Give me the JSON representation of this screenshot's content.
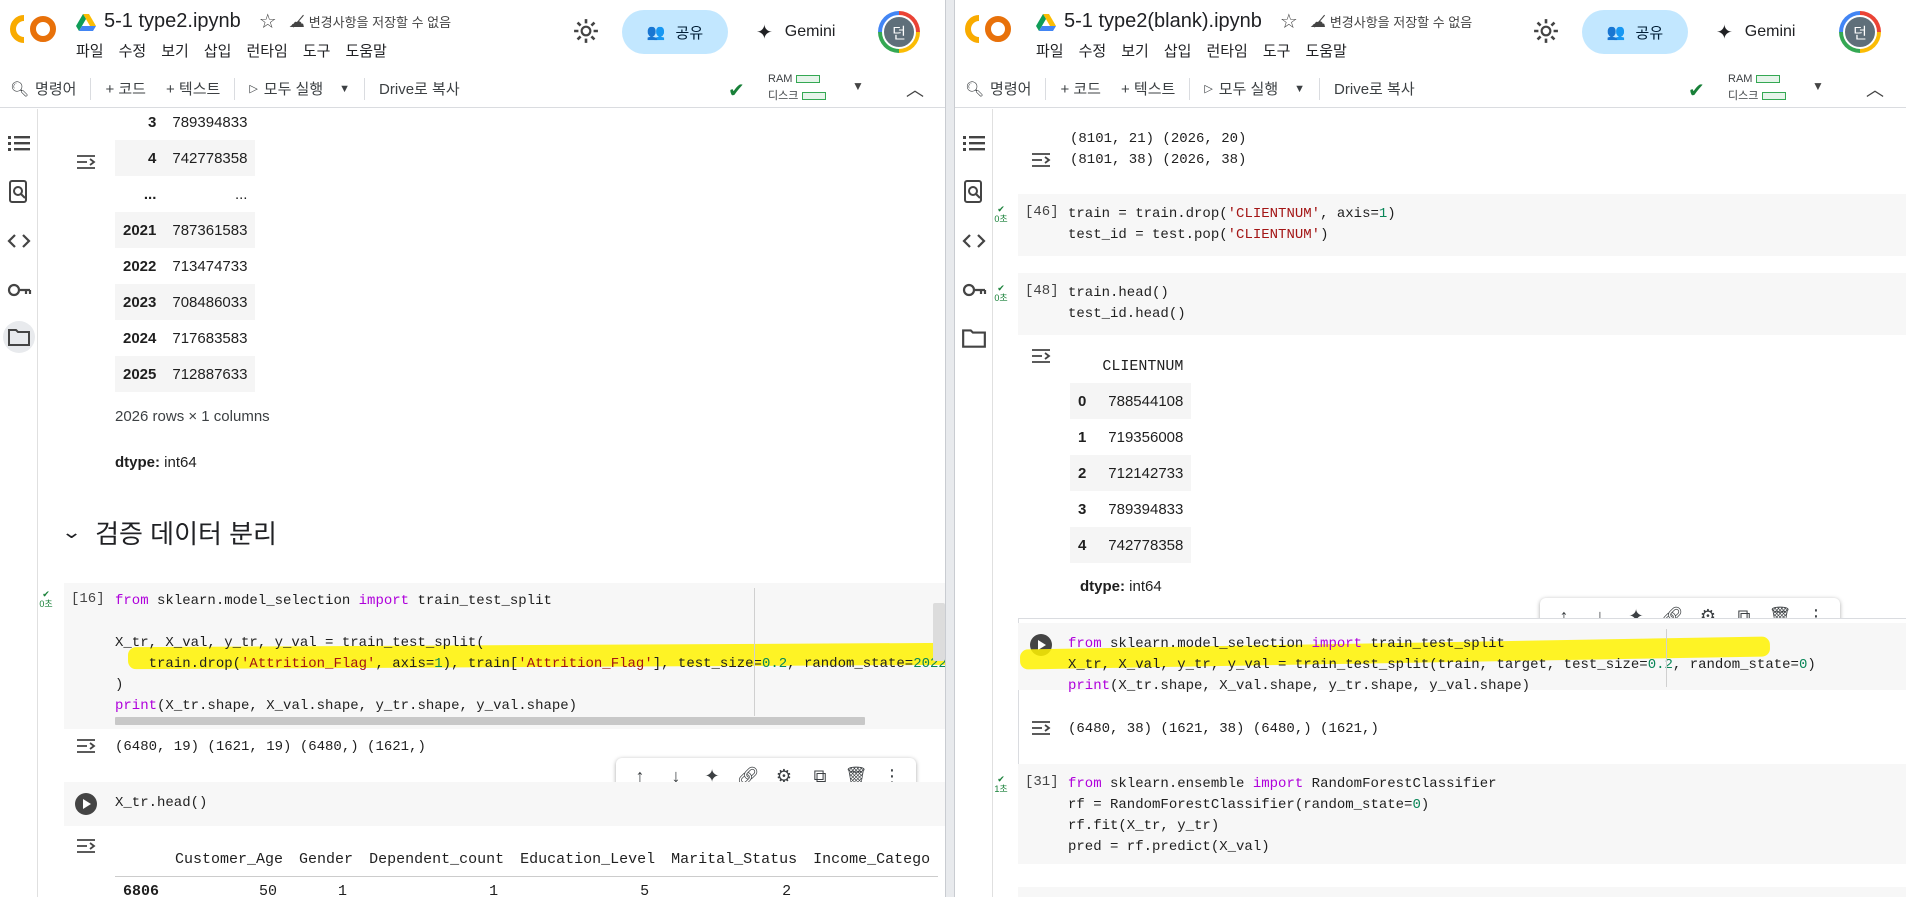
{
  "left": {
    "notebook_title": "5-1 type2.ipynb",
    "save_status": "변경사항을 저장할 수 없음",
    "menu": [
      "파일",
      "수정",
      "보기",
      "삽입",
      "런타임",
      "도구",
      "도움말"
    ],
    "share_label": "공유",
    "gemini_label": "Gemini",
    "avatar_initial": "던",
    "toolbar": {
      "commands": "명령어",
      "add_code": "+ 코드",
      "add_text": "+ 텍스트",
      "run_all": "모두 실행",
      "copy_drive": "Drive로 복사",
      "ram": "RAM",
      "disk": "디스크"
    },
    "top_table": {
      "rows": [
        [
          "3",
          "789394833"
        ],
        [
          "4",
          "742778358"
        ],
        [
          "...",
          "..."
        ],
        [
          "2021",
          "787361583"
        ],
        [
          "2022",
          "713474733"
        ],
        [
          "2023",
          "708486033"
        ],
        [
          "2024",
          "717683583"
        ],
        [
          "2025",
          "712887633"
        ]
      ],
      "summary": "2026 rows × 1 columns",
      "dtype_label": "dtype:",
      "dtype_value": "int64"
    },
    "section_title": "검증 데이터 분리",
    "cell16": {
      "exec": "[16]",
      "time": "0초",
      "output": "(6480, 19) (1621, 19) (6480,) (1621,)"
    },
    "cell_head": {
      "code": "X_tr.head()",
      "columns": [
        "Customer_Age",
        "Gender",
        "Dependent_count",
        "Education_Level",
        "Marital_Status",
        "Income_Catego"
      ],
      "row_index": "6806",
      "row_values": [
        "50",
        "1",
        "1",
        "5",
        "2",
        ""
      ]
    }
  },
  "right": {
    "notebook_title": "5-1 type2(blank).ipynb",
    "save_status": "변경사항을 저장할 수 없음",
    "menu": [
      "파일",
      "수정",
      "보기",
      "삽입",
      "런타임",
      "도구",
      "도움말"
    ],
    "share_label": "공유",
    "gemini_label": "Gemini",
    "avatar_initial": "던",
    "toolbar": {
      "commands": "명령어",
      "add_code": "+ 코드",
      "add_text": "+ 텍스트",
      "run_all": "모두 실행",
      "copy_drive": "Drive로 복사",
      "ram": "RAM",
      "disk": "디스크"
    },
    "top_output": [
      "(8101, 21) (2026, 20)",
      "(8101, 38) (2026, 38)"
    ],
    "cell46": {
      "exec": "[46]",
      "time": "0초"
    },
    "cell48": {
      "exec": "[48]",
      "time": "0초"
    },
    "clientnum_table": {
      "header": "CLIENTNUM",
      "rows": [
        [
          "0",
          "788544108"
        ],
        [
          "1",
          "719356008"
        ],
        [
          "2",
          "712142733"
        ],
        [
          "3",
          "789394833"
        ],
        [
          "4",
          "742778358"
        ]
      ],
      "dtype_label": "dtype:",
      "dtype_value": "int64"
    },
    "split_output": "(6480, 38) (1621, 38) (6480,) (1621,)",
    "cell31": {
      "exec": "[31]",
      "time": "1초"
    }
  }
}
